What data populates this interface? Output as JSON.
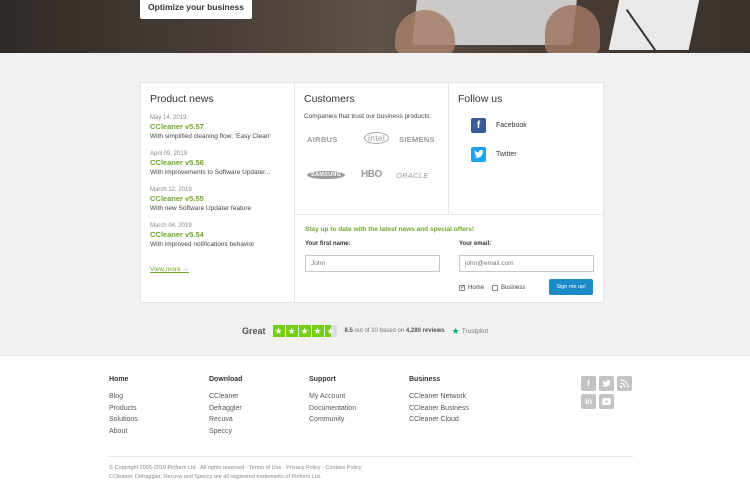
{
  "hero": {
    "cta_label": "Optimize your business"
  },
  "news": {
    "heading": "Product news",
    "items": [
      {
        "date": "May 14, 2019",
        "title": "CCleaner v5.57",
        "desc": "With simplified cleaning flow: 'Easy Clean'"
      },
      {
        "date": "April 09, 2019",
        "title": "CCleaner v5.56",
        "desc": "With improvements to Software Updater..."
      },
      {
        "date": "March 12, 2019",
        "title": "CCleaner v5.55",
        "desc": "With new Software Updater feature"
      },
      {
        "date": "March 04, 2019",
        "title": "CCleaner v5.54",
        "desc": "With improved notifications behavior"
      }
    ],
    "view_more": "View more →"
  },
  "customers": {
    "heading": "Customers",
    "desc": "Companies that trust our business products:",
    "logos": [
      "AIRBUS",
      "intel",
      "SIEMENS",
      "SAMSUNG",
      "HBO",
      "ORACLE"
    ]
  },
  "follow": {
    "heading": "Follow us",
    "items": [
      {
        "label": "Facebook",
        "icon": "facebook-icon",
        "color": "#3b5998"
      },
      {
        "label": "Twitter",
        "icon": "twitter-icon",
        "color": "#1da1f2"
      }
    ]
  },
  "signup": {
    "title": "Stay up to date with the latest news and special offers!",
    "first_name_label": "Your first name:",
    "first_name_placeholder": "John",
    "email_label": "Your email:",
    "email_placeholder": "john@email.com",
    "home_label": "Home",
    "business_label": "Business",
    "button_label": "Sign me up!",
    "home_checked": true,
    "business_checked": false
  },
  "trustpilot": {
    "rating_word": "Great",
    "score": "8.5",
    "text_mid": " out of 10 based on ",
    "reviews": "4,280 reviews",
    "brand": "Trustpilot",
    "stars": 4.5
  },
  "footer": {
    "columns": [
      {
        "heading": "Home",
        "links": [
          "Blog",
          "Products",
          "Solutions",
          "About"
        ]
      },
      {
        "heading": "Download",
        "links": [
          "CCleaner",
          "Defraggler",
          "Recuva",
          "Speccy"
        ]
      },
      {
        "heading": "Support",
        "links": [
          "My Account",
          "Documentation",
          "Community"
        ]
      },
      {
        "heading": "Business",
        "links": [
          "CCleaner Network",
          "CCleaner Business",
          "CCleaner Cloud"
        ]
      }
    ],
    "social_icons": [
      "facebook-icon",
      "twitter-icon",
      "rss-icon",
      "linkedin-icon",
      "youtube-icon"
    ],
    "copyright_line1": "© Copyright 2005-2019 Piriform Ltd - All rights reserved - Terms of Use - Privacy Policy - Cookies Policy",
    "copyright_line2": "CCleaner, Defraggler, Recuva and Speccy are all registered trademarks of Piriform Ltd."
  },
  "colors": {
    "accent_green": "#6ea82c",
    "button_blue": "#1b8bc7",
    "trustpilot_green": "#73cf11"
  }
}
